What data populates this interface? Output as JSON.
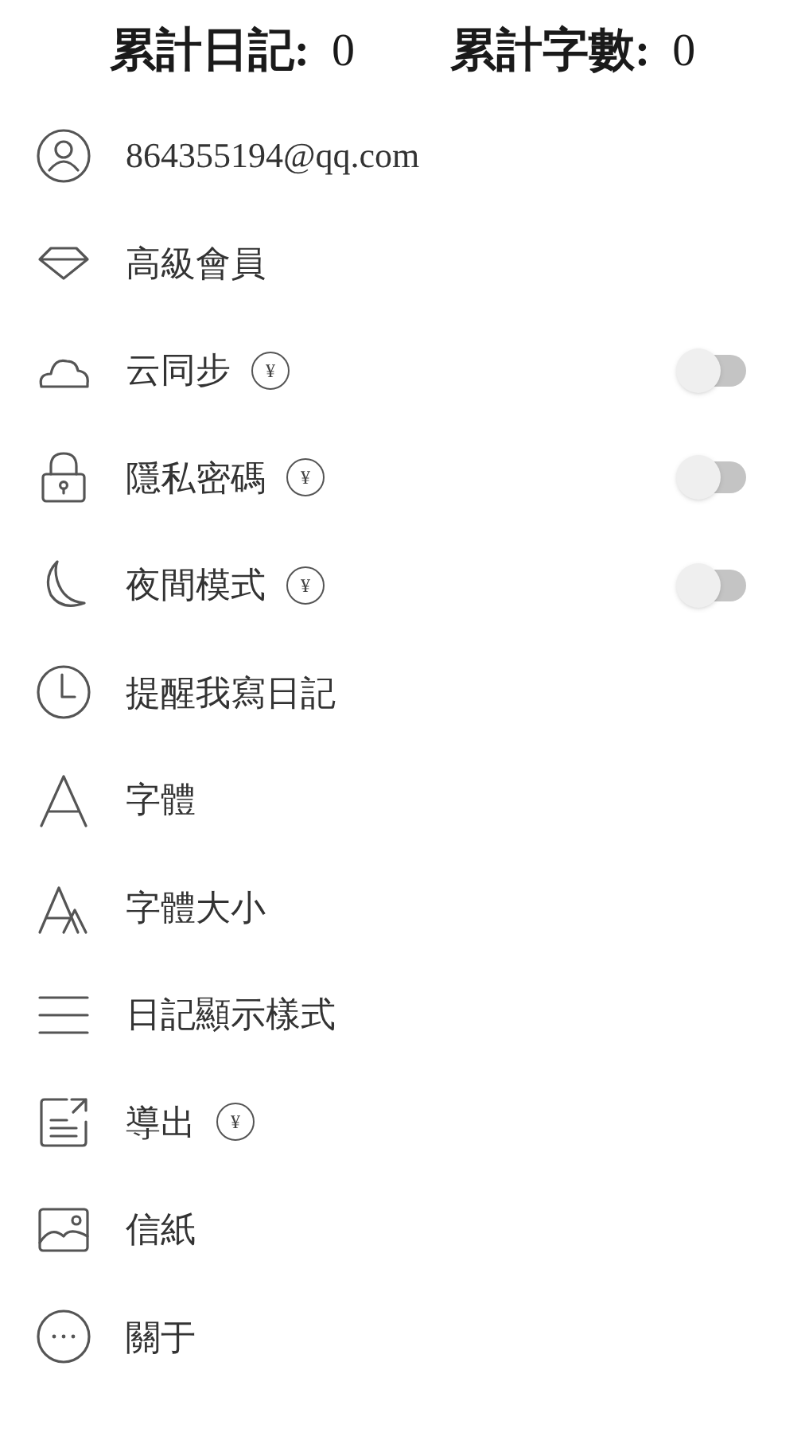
{
  "stats": [
    {
      "label": "累計日記:",
      "value": "0"
    },
    {
      "label": "累計字數:",
      "value": "0"
    }
  ],
  "items": [
    {
      "kind": "link",
      "label": "864355194@qq.com"
    },
    {
      "kind": "link",
      "label": "高級會員"
    },
    {
      "kind": "toggle",
      "label": "云同步",
      "badge": "¥",
      "on": false
    },
    {
      "kind": "toggle",
      "label": "隱私密碼",
      "badge": "¥",
      "on": false
    },
    {
      "kind": "toggle",
      "label": "夜間模式",
      "badge": "¥",
      "on": false
    },
    {
      "kind": "link",
      "label": "提醒我寫日記"
    },
    {
      "kind": "link",
      "label": "字體"
    },
    {
      "kind": "link",
      "label": "字體大小"
    },
    {
      "kind": "link",
      "label": "日記顯示樣式"
    },
    {
      "kind": "link",
      "label": "導出",
      "badge": "¥"
    },
    {
      "kind": "link",
      "label": "信紙"
    },
    {
      "kind": "link",
      "label": "關于"
    }
  ]
}
